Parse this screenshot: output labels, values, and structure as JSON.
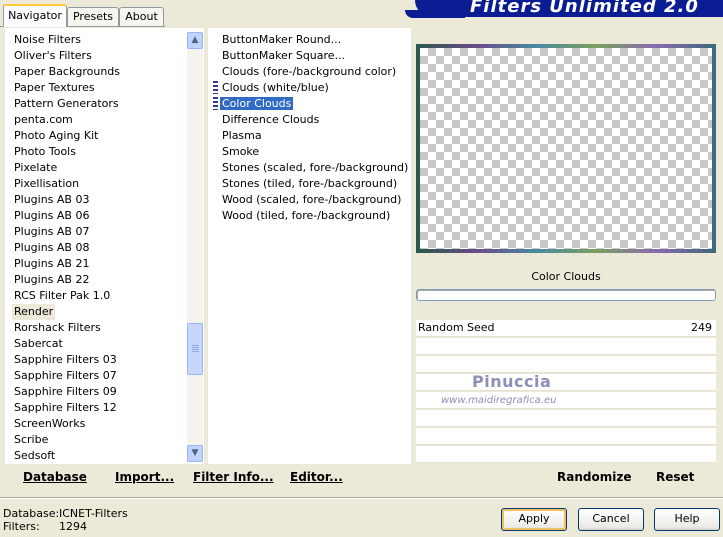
{
  "app": {
    "title": "Filters Unlimited 2.0"
  },
  "tabs": [
    {
      "label": "Navigator",
      "active": true
    },
    {
      "label": "Presets",
      "active": false
    },
    {
      "label": "About",
      "active": false
    }
  ],
  "categories": {
    "items": [
      "Noise Filters",
      "Oliver's Filters",
      "Paper Backgrounds",
      "Paper Textures",
      "Pattern Generators",
      "penta.com",
      "Photo Aging Kit",
      "Photo Tools",
      "Pixelate",
      "Pixellisation",
      "Plugins AB 03",
      "Plugins AB 06",
      "Plugins AB 07",
      "Plugins AB 08",
      "Plugins AB 21",
      "Plugins AB 22",
      "RCS Filter Pak 1.0",
      "Render",
      "Rorshack Filters",
      "Sabercat",
      "Sapphire Filters 03",
      "Sapphire Filters 07",
      "Sapphire Filters 09",
      "Sapphire Filters 12",
      "ScreenWorks",
      "Scribe",
      "Sedsoft"
    ],
    "selected": "Render"
  },
  "filters": {
    "items": [
      "ButtonMaker Round...",
      "ButtonMaker Square...",
      "Clouds (fore-/background color)",
      "Clouds (white/blue)",
      "Color Clouds",
      "Difference Clouds",
      "Plasma",
      "Smoke",
      "Stones (scaled, fore-/background)",
      "Stones (tiled, fore-/background)",
      "Wood (scaled, fore-/background)",
      "Wood (tiled, fore-/background)"
    ],
    "selected": "Color Clouds",
    "favorites": [
      "Clouds (white/blue)",
      "Color Clouds"
    ]
  },
  "preview": {
    "filter_name": "Color Clouds"
  },
  "parameters": [
    {
      "label": "Random Seed",
      "value": "249"
    }
  ],
  "watermark": {
    "line1": "Pinuccia",
    "line2": "www.maidiregrafica.eu"
  },
  "left_buttons": {
    "database": "Database",
    "import": "Import...",
    "filter_info": "Filter Info...",
    "editor": "Editor..."
  },
  "right_buttons": {
    "randomize": "Randomize",
    "reset": "Reset"
  },
  "status": {
    "database_label": "Database:",
    "database_value": "ICNET-Filters",
    "filters_label": "Filters:",
    "filters_value": "1294"
  },
  "dialog_buttons": {
    "apply": "Apply",
    "cancel": "Cancel",
    "help": "Help"
  },
  "colors": {
    "banner": "#0b1d93",
    "selection": "#316ac5",
    "panel_bg": "#ece9d8"
  }
}
